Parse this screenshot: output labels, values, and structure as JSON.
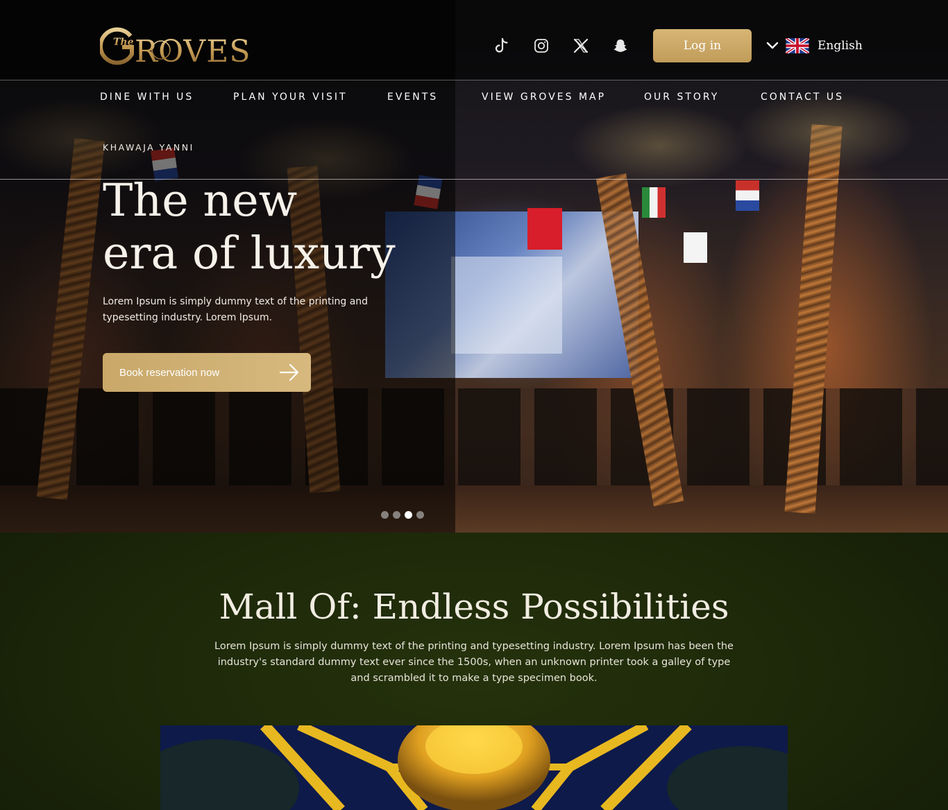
{
  "brand": {
    "logo_text": "GROVES",
    "logo_prefix": "The"
  },
  "header": {
    "social": [
      {
        "name": "tiktok-icon"
      },
      {
        "name": "instagram-icon"
      },
      {
        "name": "x-icon"
      },
      {
        "name": "snapchat-icon"
      }
    ],
    "login_label": "Log in",
    "language": {
      "selected": "English",
      "flag": "uk-flag-icon"
    }
  },
  "nav": {
    "items": [
      {
        "label": "DINE WITH US"
      },
      {
        "label": "PLAN YOUR VISIT"
      },
      {
        "label": "EVENTS"
      },
      {
        "label": "VIEW GROVES MAP"
      },
      {
        "label": "OUR STORY"
      },
      {
        "label": "CONTACT US"
      }
    ]
  },
  "hero": {
    "eyebrow": "KHAWAJA YANNI",
    "title_line1": "The new",
    "title_line2": "era of luxury",
    "description": "Lorem Ipsum is simply dummy text of the printing and typesetting industry. Lorem Ipsum.",
    "cta_label": "Book reservation now",
    "slides_total": 4,
    "active_slide": 3
  },
  "section": {
    "title": "Mall Of: Endless Possibilities",
    "description": "Lorem Ipsum is simply dummy text of the printing and typesetting industry. Lorem Ipsum has been the industry's standard dummy text ever since the 1500s, when an unknown printer took a galley of type and scrambled it to make a type specimen book."
  },
  "colors": {
    "accent_gold": "#c9a86a",
    "section_bg": "#1c2709",
    "header_bg": "#0a0a0a"
  }
}
